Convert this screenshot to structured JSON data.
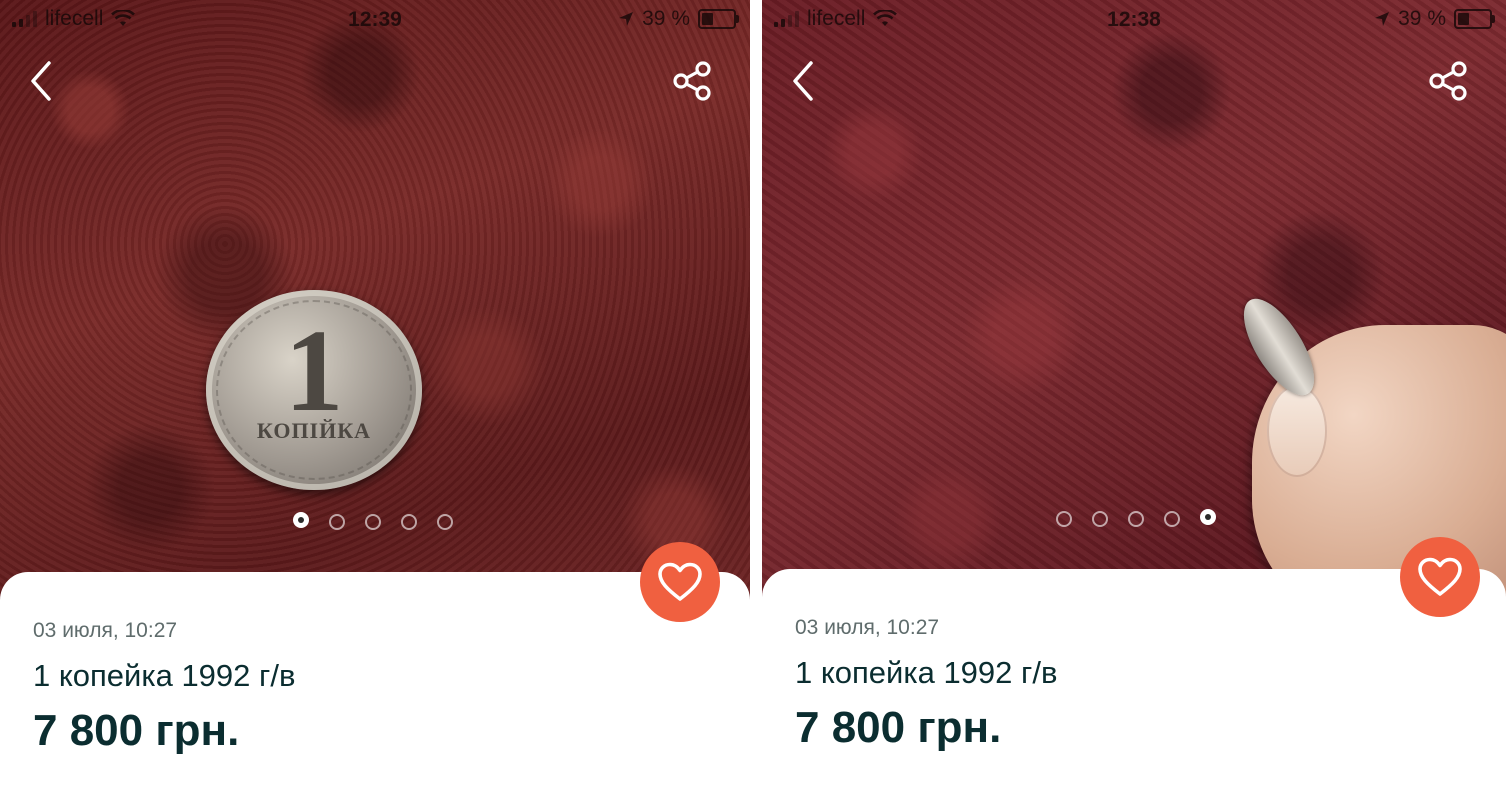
{
  "panels": [
    {
      "status": {
        "carrier": "lifecell",
        "time": "12:39",
        "battery": "39 %"
      },
      "carousel": {
        "active_index": 0,
        "count": 5
      },
      "listing": {
        "date": "03 июля, 10:27",
        "title": "1 копейка 1992 г/в",
        "price": "7 800 грн."
      },
      "coin": {
        "digit": "1",
        "word": "КОПІЙКА"
      }
    },
    {
      "status": {
        "carrier": "lifecell",
        "time": "12:38",
        "battery": "39 %"
      },
      "carousel": {
        "active_index": 4,
        "count": 5
      },
      "listing": {
        "date": "03 июля, 10:27",
        "title": "1 копейка 1992 г/в",
        "price": "7 800 грн."
      }
    }
  ],
  "icons": {
    "back": "chevron-left-icon",
    "share": "share-icon",
    "favorite": "heart-outline-icon",
    "signal": "cellular-signal-icon",
    "wifi": "wifi-icon",
    "location": "location-arrow-icon",
    "battery": "battery-icon"
  },
  "colors": {
    "accent": "#f06040",
    "text_primary": "#0b2d30",
    "text_secondary": "#5f6c6c"
  }
}
